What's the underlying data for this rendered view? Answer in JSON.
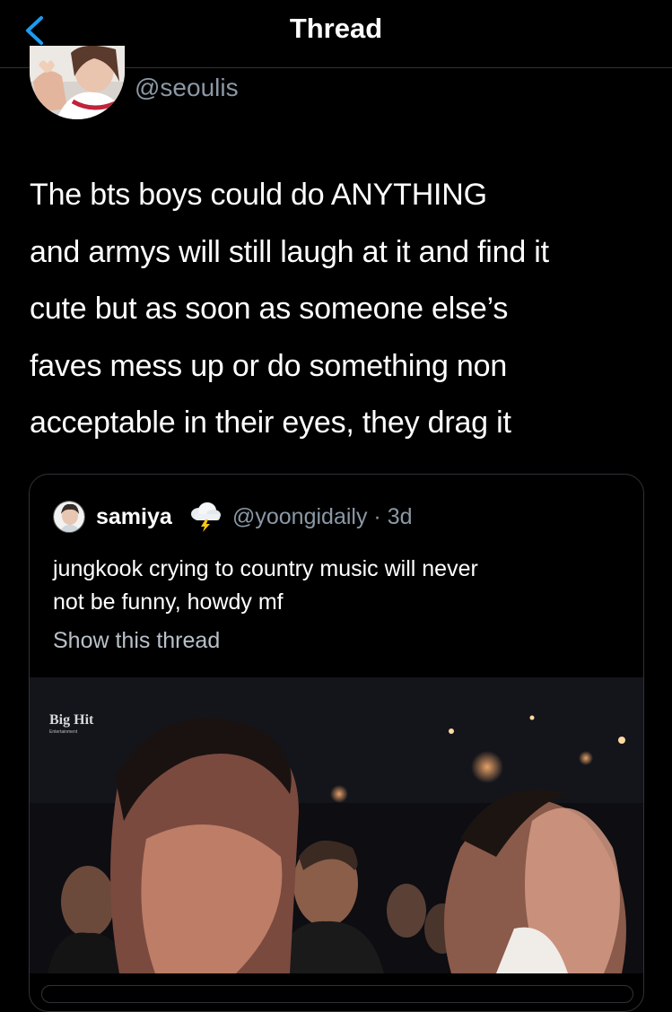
{
  "header": {
    "title": "Thread",
    "back_icon": "chevron-left-icon",
    "accent": "#1d9bf0"
  },
  "tweet": {
    "handle": "@seoulis",
    "text_lines": [
      "The bts boys could do ANYTHING",
      "and armys will still laugh at it and find it",
      "cute but as soon as someone else’s",
      "faves mess up or do something non",
      "acceptable in their eyes, they drag it"
    ]
  },
  "quote": {
    "name": "samiya",
    "badge_icon": "cloud-lightning-icon",
    "handle": "@yoongidaily",
    "separator": "·",
    "time": "3d",
    "text_lines": [
      "jungkook crying to country music will never",
      "not be funny, howdy mf"
    ],
    "show_thread": "Show this thread",
    "media": {
      "watermark_top": "Big Hit",
      "watermark_bottom": "Entertainment"
    }
  },
  "colors": {
    "background": "#000000",
    "secondary_text": "#8b98a5",
    "border": "#2f3336"
  }
}
